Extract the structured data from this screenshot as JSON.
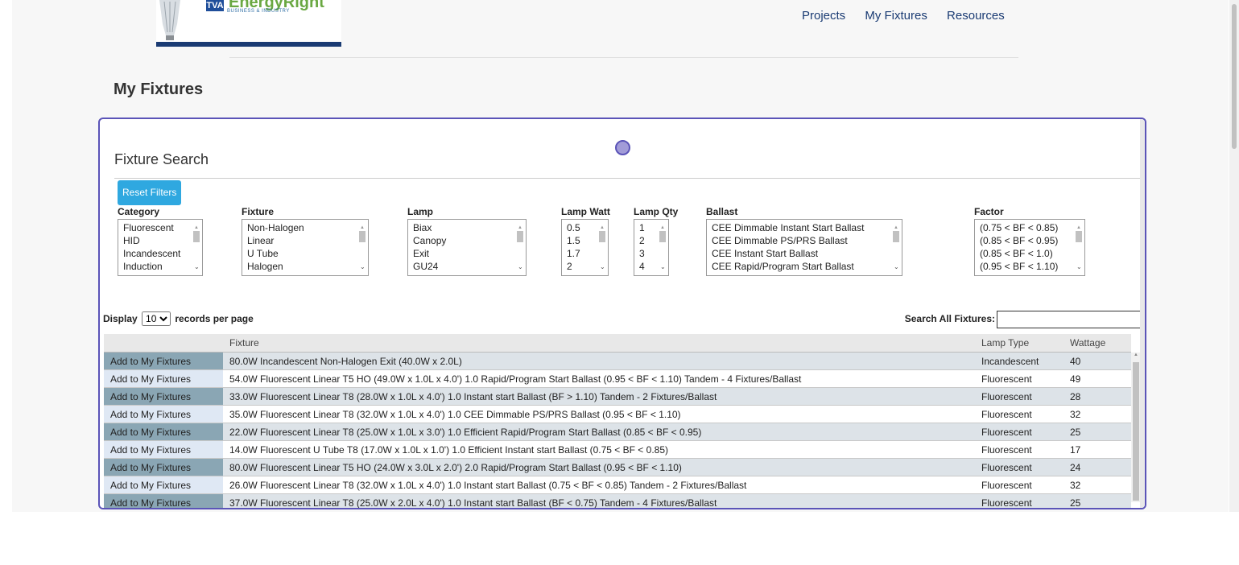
{
  "logo": {
    "tva": "TVA",
    "brand": "EnergyRight",
    "sub": "BUSINESS & INDUSTRY"
  },
  "nav": {
    "projects": "Projects",
    "my_fixtures": "My Fixtures",
    "resources": "Resources"
  },
  "page_title": "My Fixtures",
  "fixture_search": {
    "title": "Fixture Search",
    "reset_label": "Reset Filters",
    "filters": {
      "category": {
        "label": "Category",
        "options": [
          "Fluorescent",
          "HID",
          "Incandescent",
          "Induction"
        ]
      },
      "fixture": {
        "label": "Fixture",
        "options": [
          "Non-Halogen",
          "Linear",
          "U Tube",
          "Halogen"
        ]
      },
      "lamp": {
        "label": "Lamp",
        "options": [
          "Biax",
          "Canopy",
          "Exit",
          "GU24"
        ]
      },
      "lamp_watt": {
        "label": "Lamp Watt",
        "options": [
          "0.5",
          "1.5",
          "1.7",
          "2"
        ]
      },
      "lamp_qty": {
        "label": "Lamp Qty",
        "options": [
          "1",
          "2",
          "3",
          "4"
        ]
      },
      "ballast": {
        "label": "Ballast",
        "options": [
          "CEE Dimmable Instant Start Ballast",
          "CEE Dimmable PS/PRS Ballast",
          "CEE Instant Start Ballast",
          "CEE Rapid/Program Start Ballast"
        ]
      },
      "factor": {
        "label": "Factor",
        "options": [
          "(0.75 < BF < 0.85)",
          "(0.85 < BF < 0.95)",
          "(0.85 < BF < 1.0)",
          "(0.95 < BF < 1.10)"
        ]
      }
    },
    "display": {
      "prefix": "Display",
      "value": "10",
      "suffix": "records per page"
    },
    "search_label": "Search All Fixtures:",
    "table": {
      "columns": [
        "",
        "Fixture",
        "Lamp Type",
        "Wattage"
      ],
      "add_label": "Add to My Fixtures",
      "rows": [
        {
          "fixture": "80.0W Incandescent Non-Halogen Exit (40.0W x 2.0L)",
          "lamp_type": "Incandescent",
          "wattage": "40"
        },
        {
          "fixture": "54.0W Fluorescent Linear T5 HO (49.0W x 1.0L x 4.0') 1.0 Rapid/Program Start Ballast (0.95 < BF < 1.10) Tandem - 4 Fixtures/Ballast",
          "lamp_type": "Fluorescent",
          "wattage": "49"
        },
        {
          "fixture": "33.0W Fluorescent Linear T8 (28.0W x 1.0L x 4.0') 1.0 Instant start Ballast (BF > 1.10) Tandem - 2 Fixtures/Ballast",
          "lamp_type": "Fluorescent",
          "wattage": "28"
        },
        {
          "fixture": "35.0W Fluorescent Linear T8 (32.0W x 1.0L x 4.0') 1.0 CEE Dimmable PS/PRS Ballast (0.95 < BF < 1.10)",
          "lamp_type": "Fluorescent",
          "wattage": "32"
        },
        {
          "fixture": "22.0W Fluorescent Linear T8 (25.0W x 1.0L x 3.0') 1.0 Efficient Rapid/Program Start Ballast (0.85 < BF < 0.95)",
          "lamp_type": "Fluorescent",
          "wattage": "25"
        },
        {
          "fixture": "14.0W Fluorescent U Tube T8 (17.0W x 1.0L x 1.0') 1.0 Efficient Instant start Ballast (0.75 < BF < 0.85)",
          "lamp_type": "Fluorescent",
          "wattage": "17"
        },
        {
          "fixture": "80.0W Fluorescent Linear T5 HO (24.0W x 3.0L x 2.0') 2.0 Rapid/Program Start Ballast (0.95 < BF < 1.10)",
          "lamp_type": "Fluorescent",
          "wattage": "24"
        },
        {
          "fixture": "26.0W Fluorescent Linear T8 (32.0W x 1.0L x 4.0') 1.0 Instant start Ballast (0.75 < BF < 0.85) Tandem - 2 Fixtures/Ballast",
          "lamp_type": "Fluorescent",
          "wattage": "32"
        },
        {
          "fixture": "37.0W Fluorescent Linear T8 (25.0W x 2.0L x 4.0') 1.0 Instant start Ballast (BF < 0.75) Tandem - 4 Fixtures/Ballast",
          "lamp_type": "Fluorescent",
          "wattage": "25"
        }
      ]
    }
  }
}
